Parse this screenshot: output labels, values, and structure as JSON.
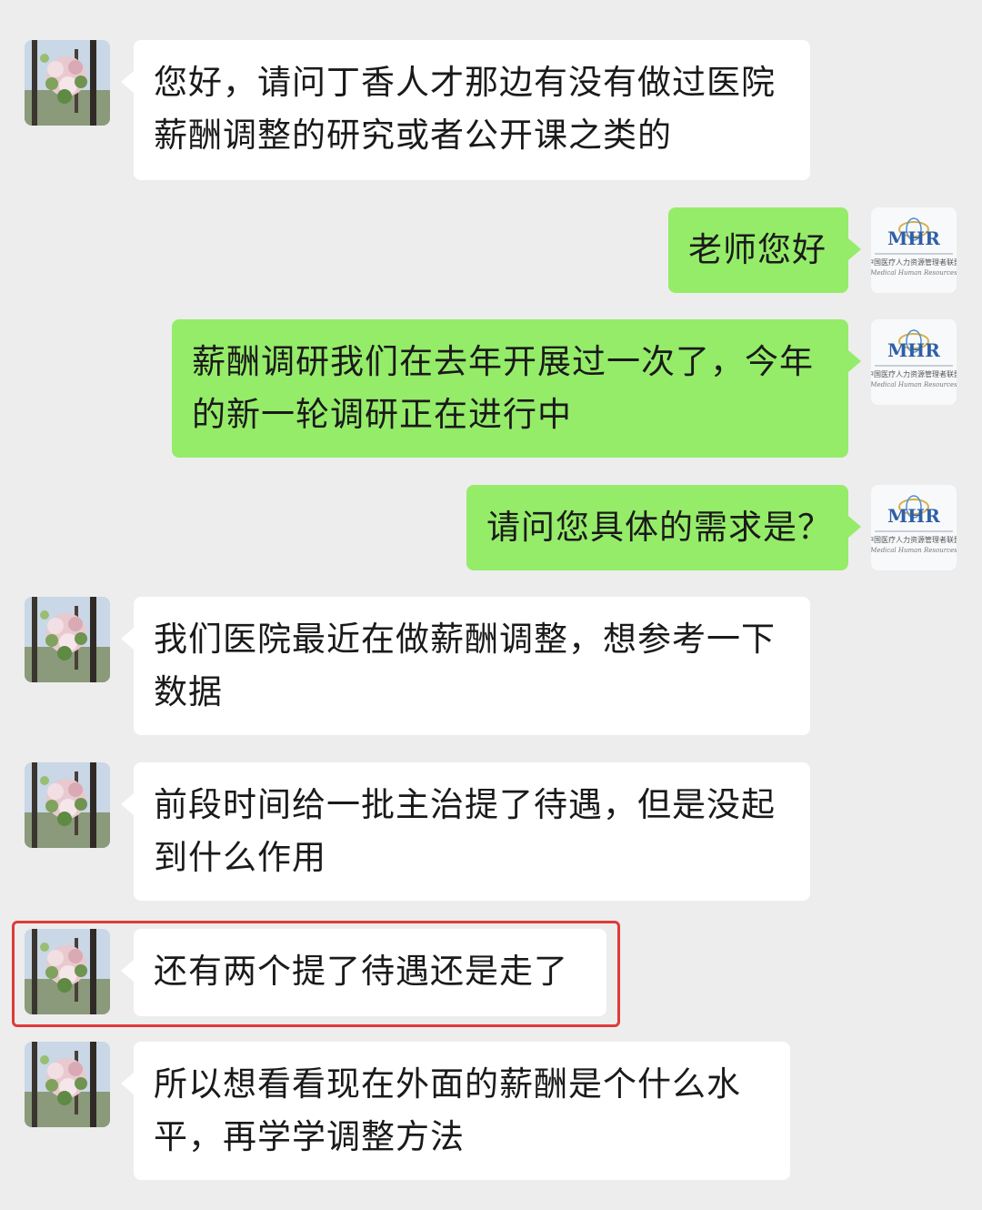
{
  "colors": {
    "background": "#ededed",
    "incoming_bubble": "#ffffff",
    "outgoing_bubble": "#95ec69",
    "highlight": "#e03a3a"
  },
  "contacts": {
    "user_avatar": "flower-photo-avatar",
    "staff_avatar": {
      "logo_text": "MHR",
      "logo_subtitle_cn": "中国医疗人力资源管理者联盟",
      "logo_subtitle_en": "Medical Human Resources"
    }
  },
  "messages": [
    {
      "from": "user",
      "lines": [
        "您好，请问丁香人才那边有没有做过医院",
        "薪酬调整的研究或者公开课之类的"
      ]
    },
    {
      "from": "staff",
      "lines": [
        "老师您好"
      ]
    },
    {
      "from": "staff",
      "lines": [
        "薪酬调研我们在去年开展过一次了，今年",
        "的新一轮调研正在进行中"
      ]
    },
    {
      "from": "staff",
      "lines": [
        "请问您具体的需求是？"
      ]
    },
    {
      "from": "user",
      "lines": [
        "我们医院最近在做薪酬调整，想参考一下",
        "数据"
      ]
    },
    {
      "from": "user",
      "lines": [
        "前段时间给一批主治提了待遇，但是没起",
        "到什么作用"
      ]
    },
    {
      "from": "user",
      "lines": [
        "还有两个提了待遇还是走了"
      ],
      "highlighted": true
    },
    {
      "from": "user",
      "lines": [
        "所以想看看现在外面的薪酬是个什么水",
        "平，再学学调整方法"
      ]
    }
  ]
}
